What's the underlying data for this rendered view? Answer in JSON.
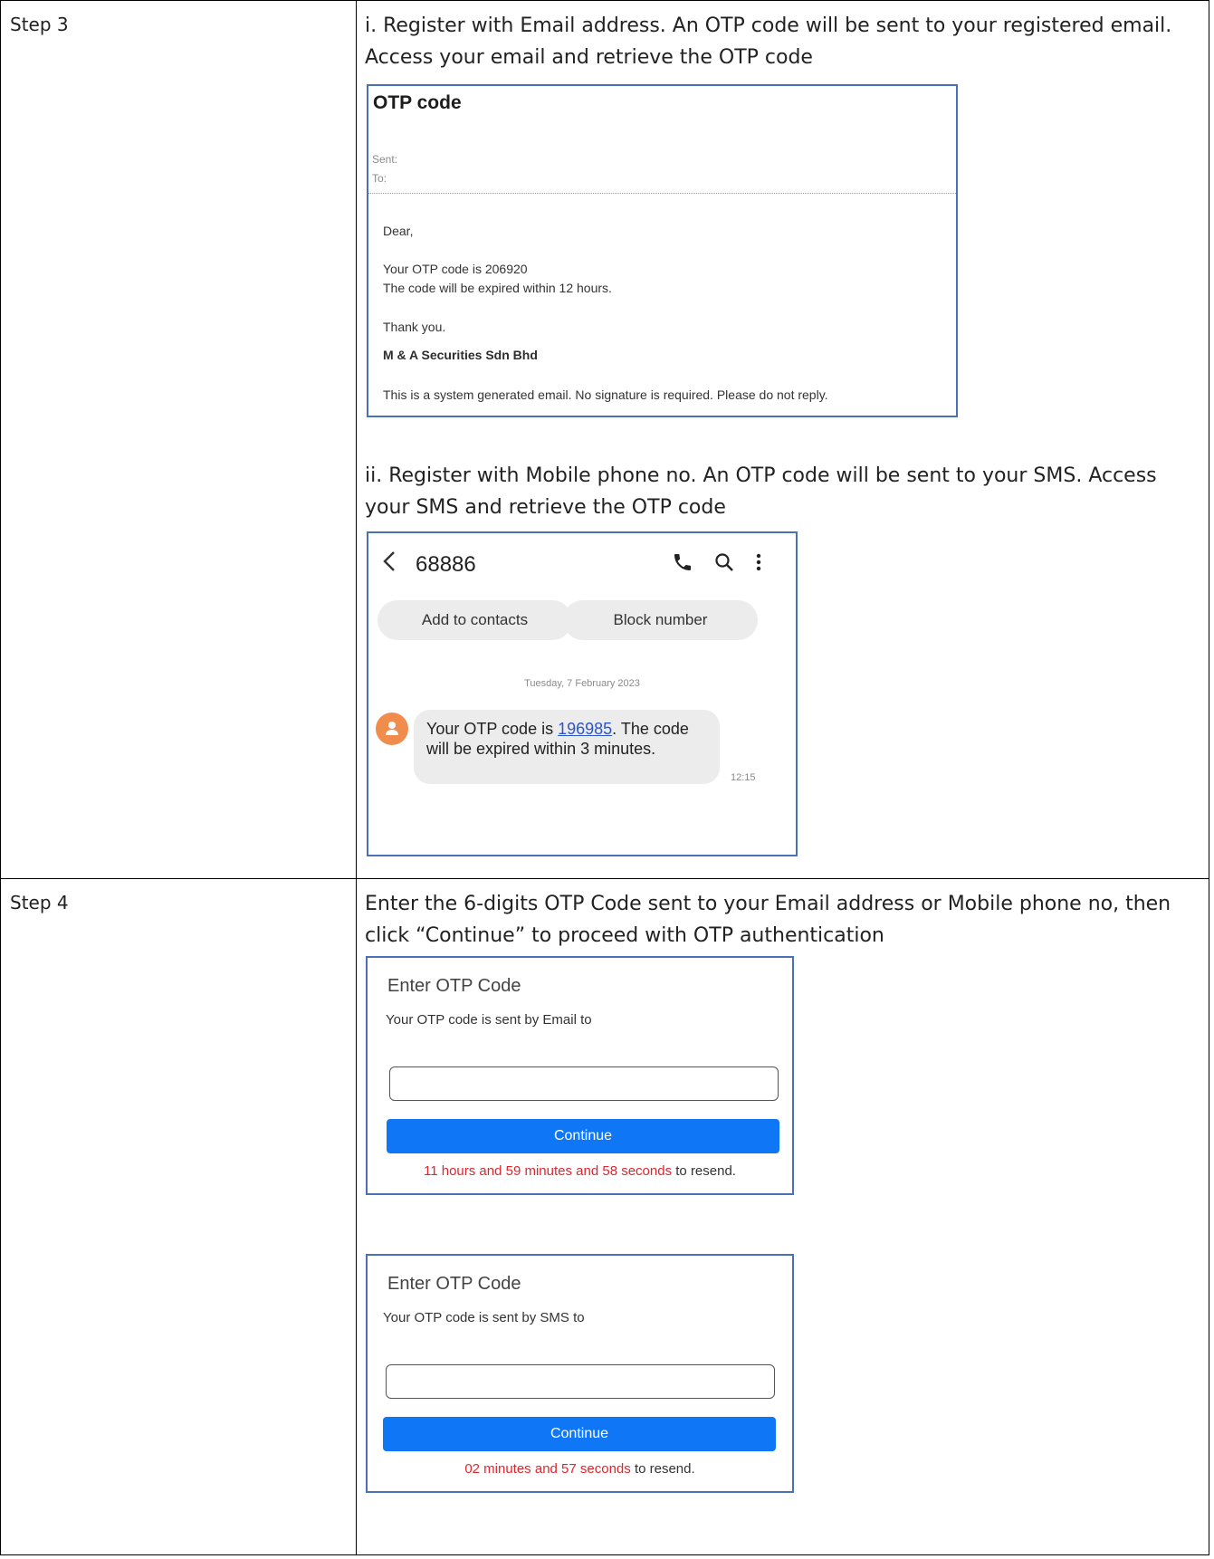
{
  "step3": {
    "label": "Step 3",
    "instruction_email": "i. Register with Email address. An OTP code will be sent to your registered email. Access your email and retrieve the OTP code",
    "email": {
      "subject": "OTP code",
      "sent_label": "Sent:",
      "to_label": "To:",
      "greeting": "Dear,",
      "line1": "Your OTP code is 206920",
      "line2": "The code will be expired within 12 hours.",
      "thanks": "Thank you.",
      "company": "M & A Securities Sdn Bhd",
      "footer": "This is a system generated email. No signature is required. Please do not reply."
    },
    "instruction_sms": "ii. Register with Mobile phone no. An OTP code will be sent to your SMS. Access your SMS and retrieve the OTP code",
    "sms": {
      "sender": "68886",
      "add_contacts": "Add to contacts",
      "block_number": "Block number",
      "date": "Tuesday, 7 February 2023",
      "message_prefix": "Your OTP code is ",
      "otp_code": "196985",
      "message_suffix": ". The code will be expired within 3 minutes.",
      "time": "12:15"
    }
  },
  "step4": {
    "label": "Step 4",
    "instruction": "Enter the 6-digits OTP Code sent to your Email address or Mobile phone no, then click “Continue” to proceed with OTP authentication",
    "email_panel": {
      "title": "Enter OTP Code",
      "subtitle": "Your OTP code is sent by Email to",
      "input_value": "",
      "button": "Continue",
      "countdown": "11 hours and 59 minutes and 58 seconds",
      "resend_suffix": " to resend."
    },
    "sms_panel": {
      "title": "Enter OTP Code",
      "subtitle": "Your OTP code is sent by SMS to",
      "input_value": "",
      "button": "Continue",
      "countdown": "02 minutes and 57 seconds",
      "resend_suffix": " to resend."
    }
  },
  "colors": {
    "frame_border": "#4a70b8",
    "button_blue": "#0f77f5",
    "countdown_red": "#e0252d",
    "avatar_orange": "#f08c4c",
    "link_blue": "#2c55c8"
  },
  "icons": [
    "back-chevron-icon",
    "phone-icon",
    "search-icon",
    "more-vertical-icon",
    "person-icon"
  ]
}
